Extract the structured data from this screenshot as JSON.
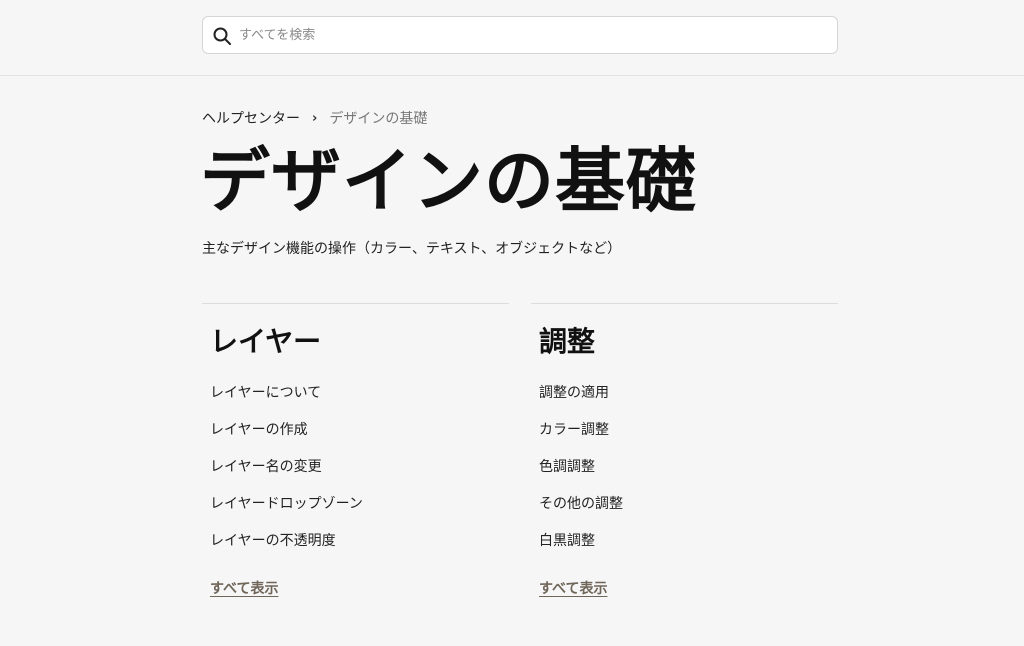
{
  "search": {
    "placeholder": "すべてを検索",
    "value": ""
  },
  "breadcrumb": {
    "home": "ヘルプセンター",
    "separator": "›",
    "current": "デザインの基礎"
  },
  "page": {
    "title": "デザインの基礎",
    "subtitle": "主なデザイン機能の操作（カラー、テキスト、オブジェクトなど）"
  },
  "sections": [
    {
      "heading": "レイヤー",
      "items": [
        "レイヤーについて",
        "レイヤーの作成",
        "レイヤー名の変更",
        "レイヤードロップゾーン",
        "レイヤーの不透明度"
      ],
      "see_all": "すべて表示"
    },
    {
      "heading": "調整",
      "items": [
        "調整の適用",
        "カラー調整",
        "色調調整",
        "その他の調整",
        "白黒調整"
      ],
      "see_all": "すべて表示"
    }
  ],
  "colors": {
    "background": "#f6f6f6",
    "link_accent": "#6f6558",
    "muted_text": "#777777"
  }
}
